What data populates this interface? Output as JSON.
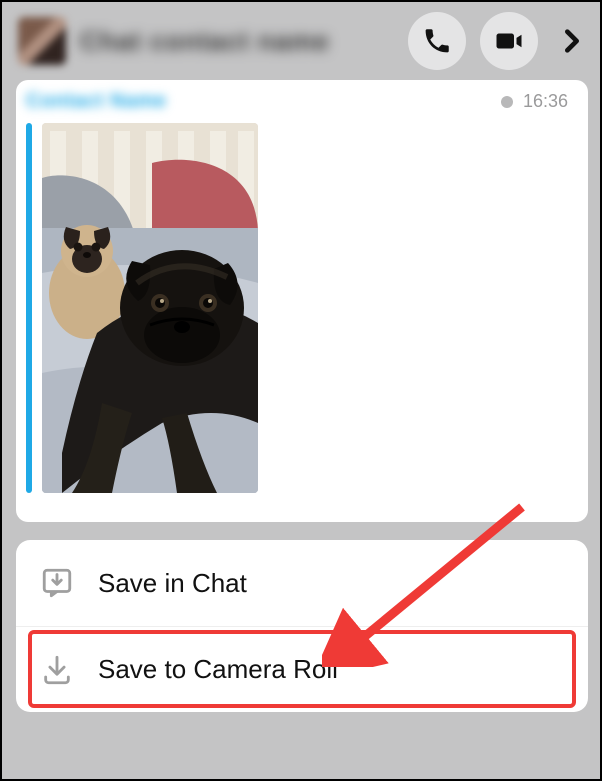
{
  "header": {
    "title": "Chat contact name",
    "call_label": "Voice call",
    "video_label": "Video call",
    "more_label": "More"
  },
  "message": {
    "sender": "Contact Name",
    "timestamp": "16:36",
    "image_alt": "Photo of two pugs on a bed"
  },
  "actions": {
    "save_in_chat": "Save in Chat",
    "save_to_camera_roll": "Save to Camera Roll"
  }
}
